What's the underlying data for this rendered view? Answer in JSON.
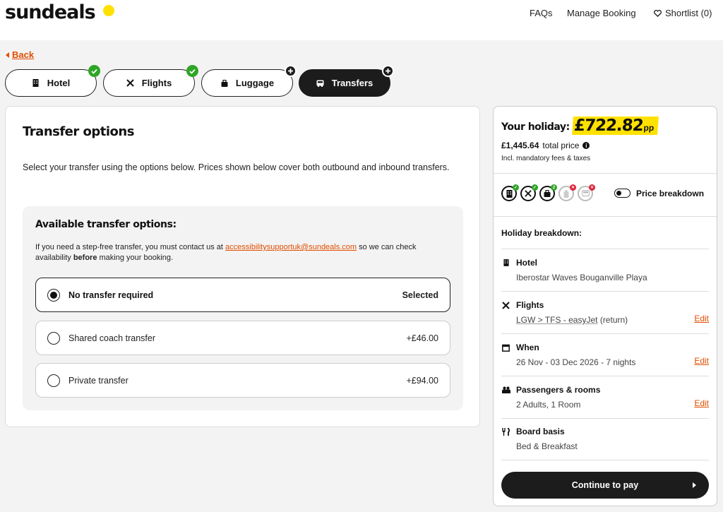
{
  "brand": {
    "name": "sundeals",
    "dot_color": "#ffe100"
  },
  "nav": {
    "faqs": "FAQs",
    "manage_booking": "Manage Booking",
    "shortlist": "Shortlist (0)"
  },
  "back_label": "Back",
  "steps": [
    {
      "label": "Hotel",
      "icon": "building-icon",
      "status": "complete"
    },
    {
      "label": "Flights",
      "icon": "plane-icon",
      "status": "complete"
    },
    {
      "label": "Luggage",
      "icon": "luggage-icon",
      "status": "add"
    },
    {
      "label": "Transfers",
      "icon": "bus-icon",
      "status": "add",
      "active": true
    }
  ],
  "main": {
    "title": "Transfer options",
    "description": "Select your transfer using the options below. Prices shown below cover both outbound and inbound transfers.",
    "options_title": "Available transfer options:",
    "note_before_link": "If you need a step-free transfer, you must contact us at ",
    "note_link": "accessibilitysupportuk@sundeals.com",
    "note_after_link": " so we can check availability ",
    "note_bold": "before",
    "note_end": " making your booking.",
    "options": [
      {
        "label": "No transfer required",
        "price": "Selected",
        "selected": true
      },
      {
        "label": "Shared coach transfer",
        "price": "+£46.00",
        "selected": false
      },
      {
        "label": "Private transfer",
        "price": "+£94.00",
        "selected": false
      }
    ]
  },
  "sidebar": {
    "holiday_label": "Your holiday:",
    "price_pp": "£722.82",
    "pp": "pp",
    "total_amount": "£1,445.64",
    "total_label": "total price",
    "incl_note": "Incl. mandatory fees & taxes",
    "status_icons": [
      {
        "icon": "building-icon",
        "status": "complete"
      },
      {
        "icon": "plane-icon",
        "status": "complete"
      },
      {
        "icon": "luggage-icon",
        "status": "complete",
        "badge": "2"
      },
      {
        "icon": "suitcase-icon",
        "status": "missing"
      },
      {
        "icon": "bus-icon",
        "status": "missing"
      }
    ],
    "price_breakdown_label": "Price breakdown",
    "breakdown_title": "Holiday breakdown:",
    "rows": [
      {
        "heading": "Hotel",
        "value": "Iberostar Waves Bouganville Playa",
        "icon": "building-icon"
      },
      {
        "heading": "Flights",
        "value_link": "LGW > TFS - easyJet",
        "value_suffix": " (return)",
        "edit": "Edit",
        "icon": "plane-icon"
      },
      {
        "heading": "When",
        "value": "26 Nov - 03 Dec 2026 - 7 nights",
        "edit": "Edit",
        "icon": "calendar-icon"
      },
      {
        "heading": "Passengers & rooms",
        "value": "2 Adults, 1 Room",
        "edit": "Edit",
        "icon": "people-icon"
      },
      {
        "heading": "Board basis",
        "value": "Bed & Breakfast",
        "icon": "cutlery-icon"
      }
    ],
    "cta": "Continue to pay"
  },
  "colors": {
    "accent": "#e04d00",
    "check": "#2fa526",
    "cross": "#e0223a",
    "highlight": "#ffe100"
  }
}
